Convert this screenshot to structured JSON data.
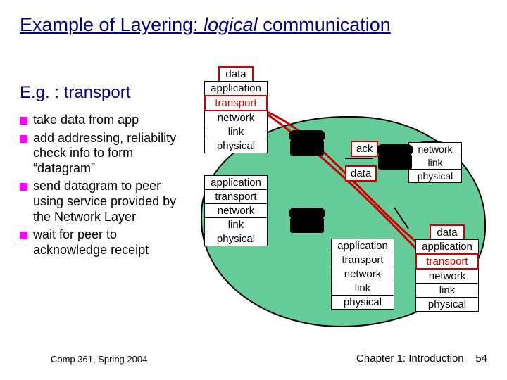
{
  "title_a": "Example of Layering: ",
  "title_b": "logical",
  "title_c": " communication",
  "subhead": "E.g. : transport",
  "bullets": [
    "take data from app",
    "add addressing, reliability check info to form “datagram”",
    "send datagram to peer using service provided by the Network Layer",
    "wait for peer to acknowledge receipt"
  ],
  "layers5": [
    "application",
    "transport",
    "network",
    "link",
    "physical"
  ],
  "layers3": [
    "network",
    "link",
    "physical"
  ],
  "data_label": "data",
  "ack_label": "ack",
  "footer_left": "Comp 361,    Spring 2004",
  "footer_right_a": "Chapter 1: Introduction",
  "footer_right_b": "54"
}
